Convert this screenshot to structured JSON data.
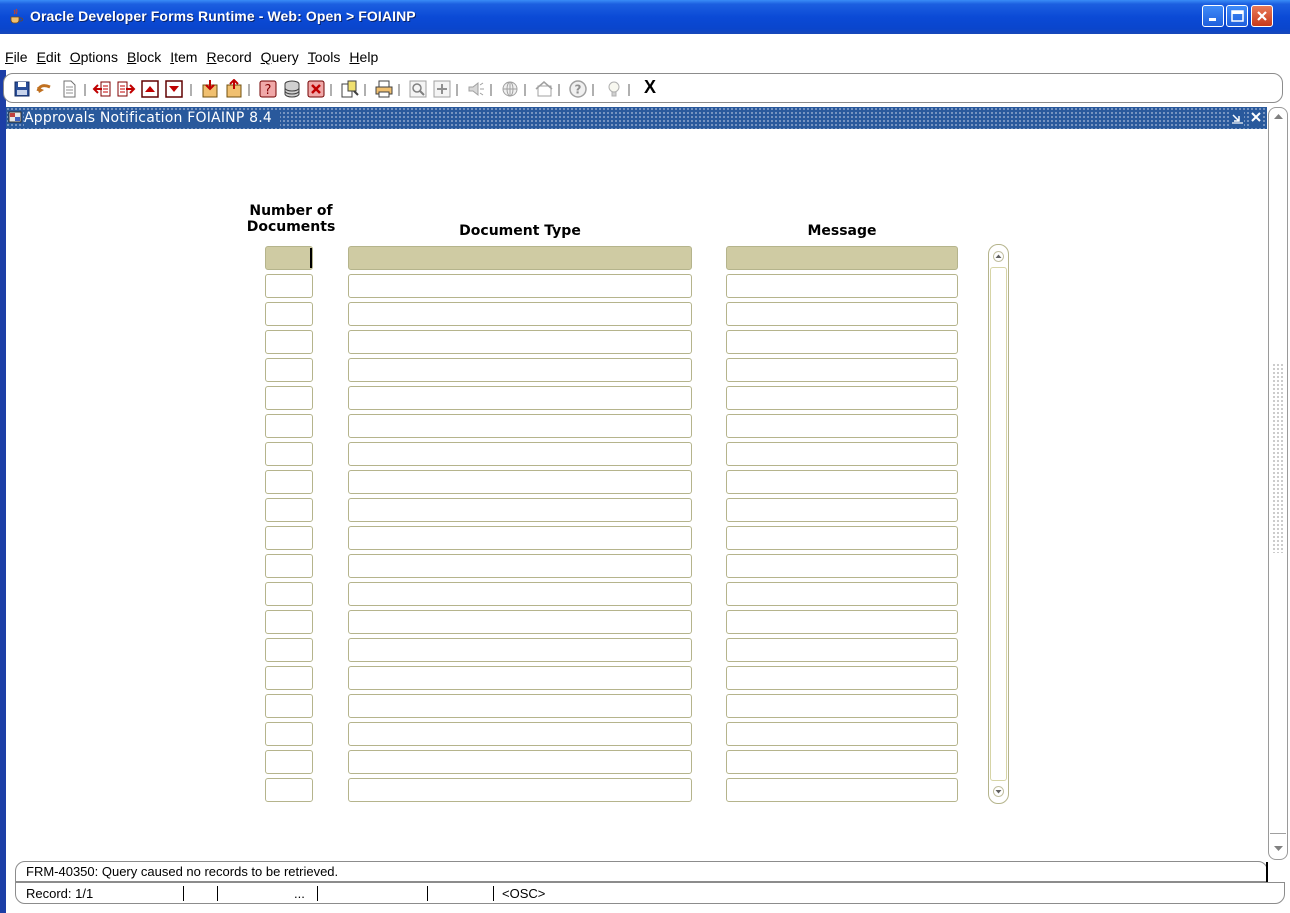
{
  "window": {
    "title": "Oracle Developer Forms Runtime - Web:  Open > FOIAINP"
  },
  "menu": {
    "items": [
      {
        "accel": "F",
        "rest": "ile"
      },
      {
        "accel": "E",
        "rest": "dit"
      },
      {
        "accel": "O",
        "rest": "ptions"
      },
      {
        "accel": "B",
        "rest": "lock"
      },
      {
        "accel": "I",
        "rest": "tem"
      },
      {
        "accel": "R",
        "rest": "ecord"
      },
      {
        "accel": "Q",
        "rest": "uery"
      },
      {
        "accel": "T",
        "rest": "ools"
      },
      {
        "accel": "H",
        "rest": "elp"
      }
    ]
  },
  "toolbar": {
    "exit_label": "X"
  },
  "form": {
    "title": "Approvals Notification  FOIAINP  8.4",
    "columns": {
      "num_docs_line1": "Number of",
      "num_docs_line2": "Documents",
      "doc_type": "Document Type",
      "message": "Message"
    }
  },
  "status": {
    "message": "FRM-40350: Query caused no records to be retrieved.",
    "record": "Record: 1/1",
    "ellipsis": "...",
    "osc": "<OSC>"
  },
  "colors": {
    "title_bar": "#0b4ad6",
    "form_title_bar": "#29599c",
    "active_field": "#cfcba3",
    "field_border": "#b5b48c"
  }
}
